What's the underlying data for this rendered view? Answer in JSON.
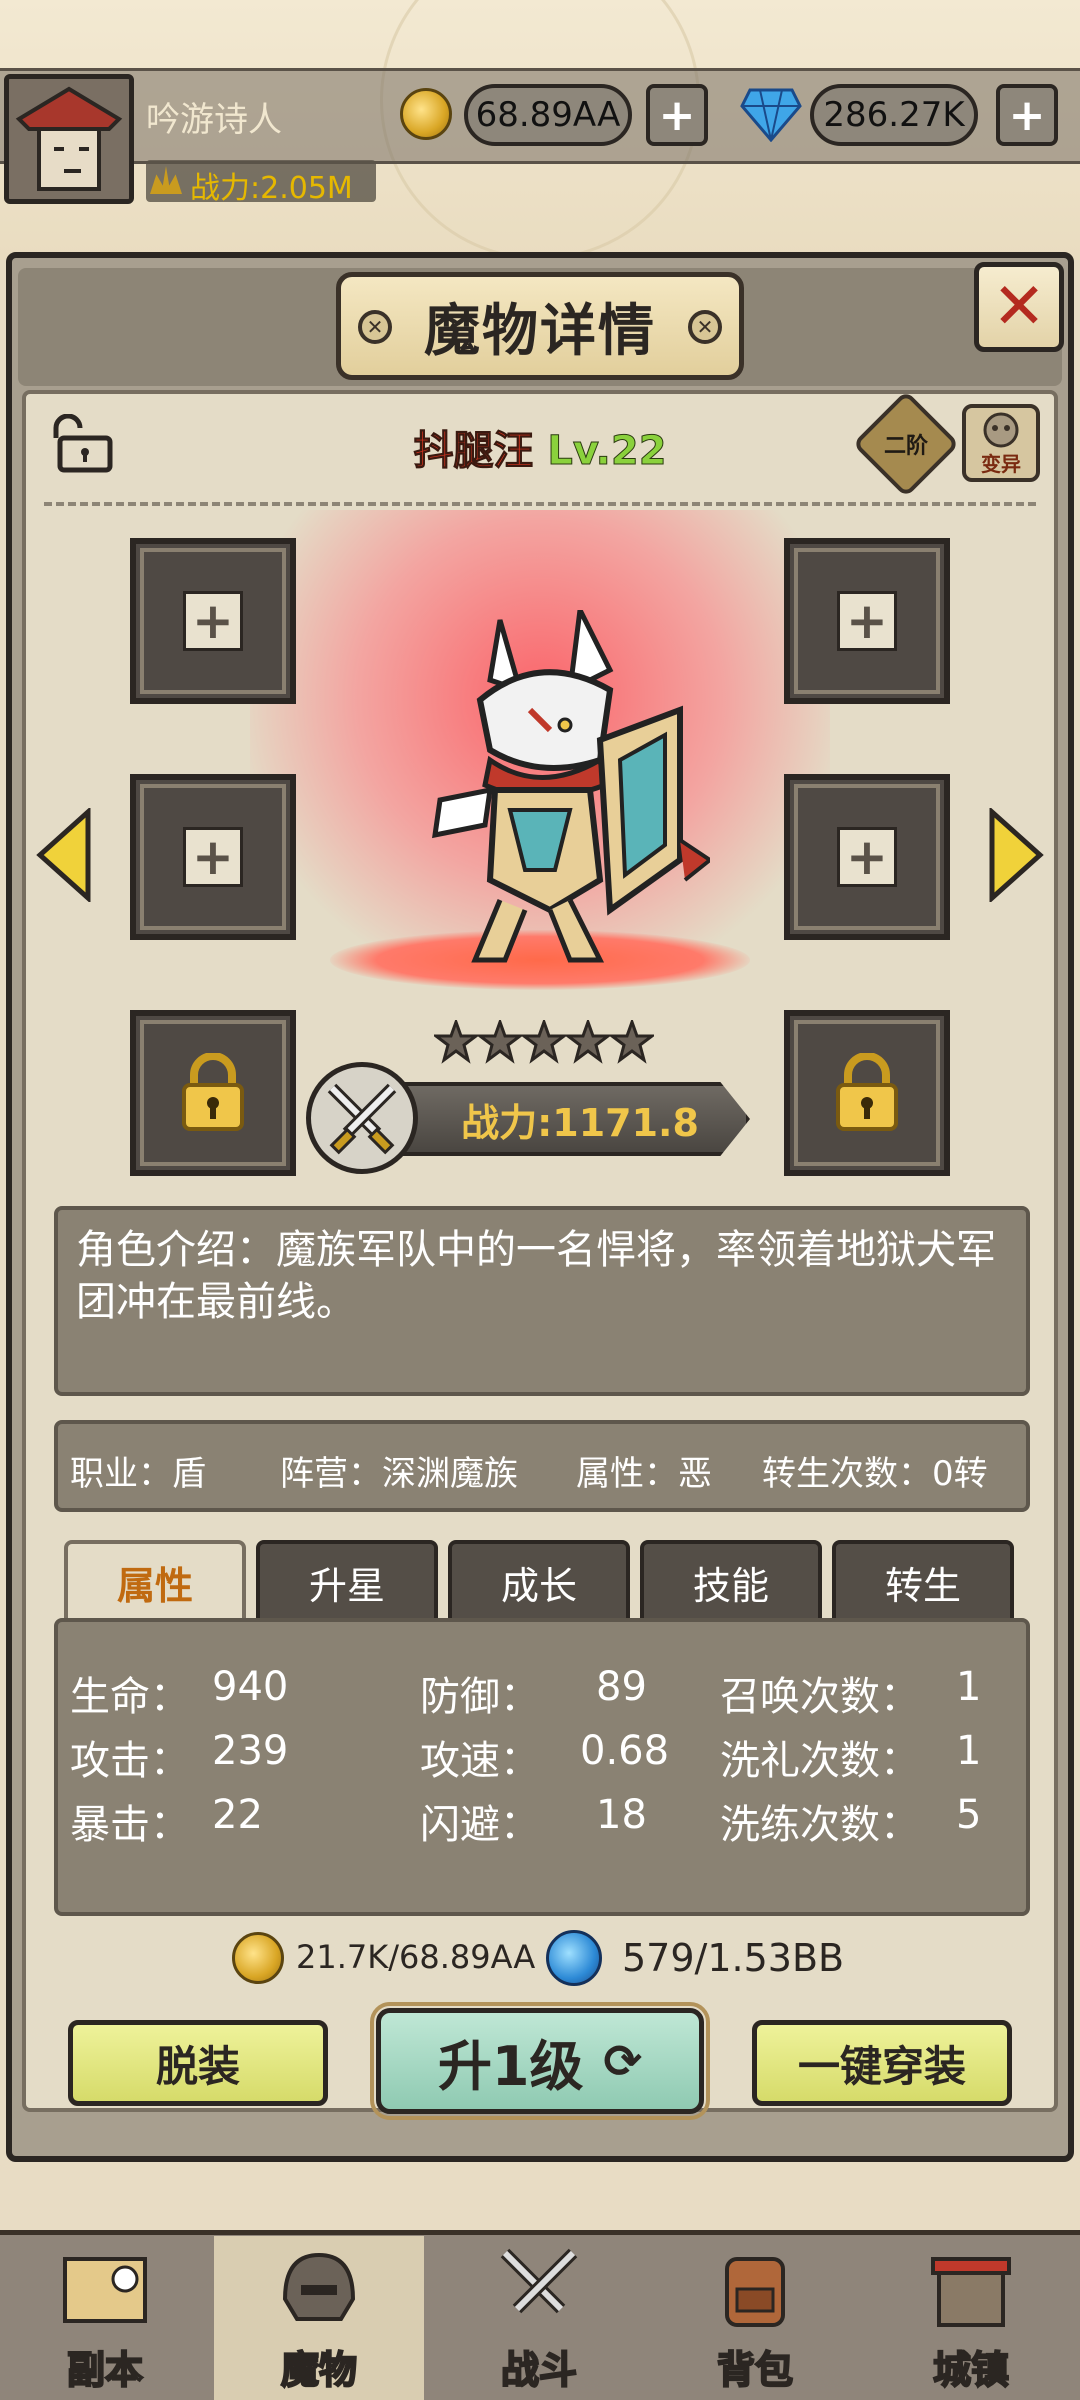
{
  "player": {
    "name": "吟游诗人",
    "power_label": "战力:2.05M",
    "gold": "68.89AA",
    "diamond": "286.27K"
  },
  "panel": {
    "title": "魔物详情"
  },
  "monster": {
    "name": "抖腿汪",
    "level": "Lv.22",
    "tier": "二阶",
    "mutate_label": "变异",
    "stars": 5,
    "power": "战力:1171.8",
    "description": "角色介绍：魔族军队中的一名悍将，率领着地狱犬军团冲在最前线。",
    "info": {
      "job": "职业：盾",
      "faction": "阵营：深渊魔族",
      "attribute": "属性：恶",
      "rebirth": "转生次数：0转"
    }
  },
  "tabs": [
    "属性",
    "升星",
    "成长",
    "技能",
    "转生"
  ],
  "stats": {
    "col1": [
      {
        "label": "生命：",
        "value": "940"
      },
      {
        "label": "攻击：",
        "value": "239"
      },
      {
        "label": "暴击：",
        "value": "22"
      }
    ],
    "col2": [
      {
        "label": "防御：",
        "value": "89"
      },
      {
        "label": "攻速：",
        "value": "0.68"
      },
      {
        "label": "闪避：",
        "value": "18"
      }
    ],
    "col3": [
      {
        "label": "召唤次数：",
        "value": "1"
      },
      {
        "label": "洗礼次数：",
        "value": "1"
      },
      {
        "label": "洗练次数：",
        "value": "5"
      }
    ]
  },
  "cost": {
    "gold": "21.7K/68.89AA",
    "orb": "579/1.53BB"
  },
  "buttons": {
    "unequip": "脱装",
    "upgrade": "升1级",
    "equip_all": "一键穿装"
  },
  "nav": [
    "副本",
    "魔物",
    "战斗",
    "背包",
    "城镇"
  ],
  "colors": {
    "accent_gold": "#f0c64a",
    "name_red": "#d8341f",
    "level_green": "#8ad13c",
    "close_red": "#b42a1f"
  }
}
